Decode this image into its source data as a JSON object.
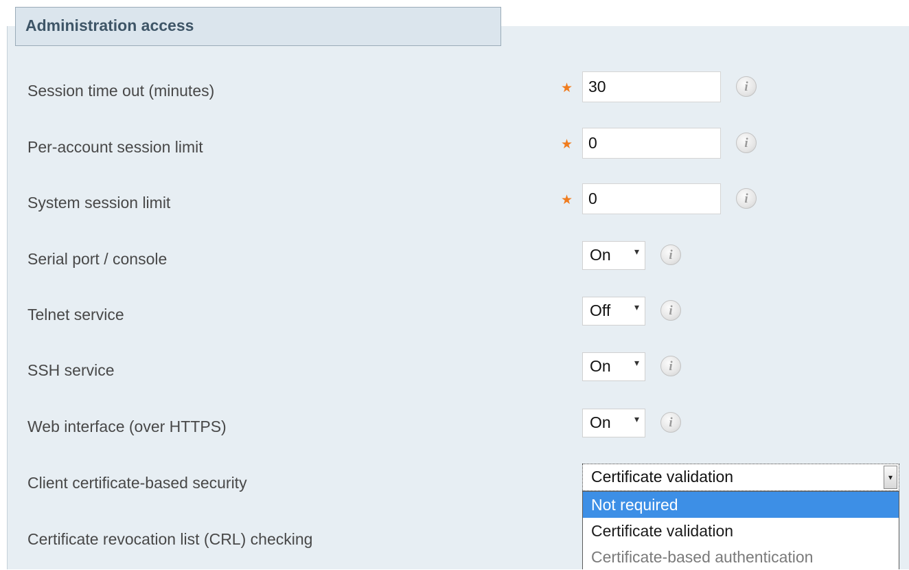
{
  "section": {
    "title": "Administration access"
  },
  "fields": {
    "session_timeout": {
      "label": "Session time out (minutes)",
      "value": "30",
      "required_marker": "★"
    },
    "per_account_limit": {
      "label": "Per-account session limit",
      "value": "0",
      "required_marker": "★"
    },
    "system_limit": {
      "label": "System session limit",
      "value": "0",
      "required_marker": "★"
    },
    "serial_port": {
      "label": "Serial port / console",
      "value": "On",
      "arrow": "▾"
    },
    "telnet": {
      "label": "Telnet service",
      "value": "Off",
      "arrow": "▾"
    },
    "ssh": {
      "label": "SSH service",
      "value": "On",
      "arrow": "▾"
    },
    "web_interface": {
      "label": "Web interface (over HTTPS)",
      "value": "On",
      "arrow": "▾"
    },
    "client_cert": {
      "label": "Client certificate-based security",
      "value": "Certificate validation",
      "arrow": "▾",
      "options": [
        "Not required",
        "Certificate validation",
        "Certificate-based authentication"
      ],
      "highlighted_option": "Not required"
    },
    "crl": {
      "label": "Certificate revocation list (CRL) checking"
    }
  },
  "info_icon_glyph": "i",
  "colors": {
    "panel_bg": "#e7eef3",
    "required_star": "#f07c1e",
    "option_highlight": "#3d8fe6"
  },
  "icons": [
    "info-icon",
    "required-star-icon",
    "dropdown-arrow-icon"
  ]
}
